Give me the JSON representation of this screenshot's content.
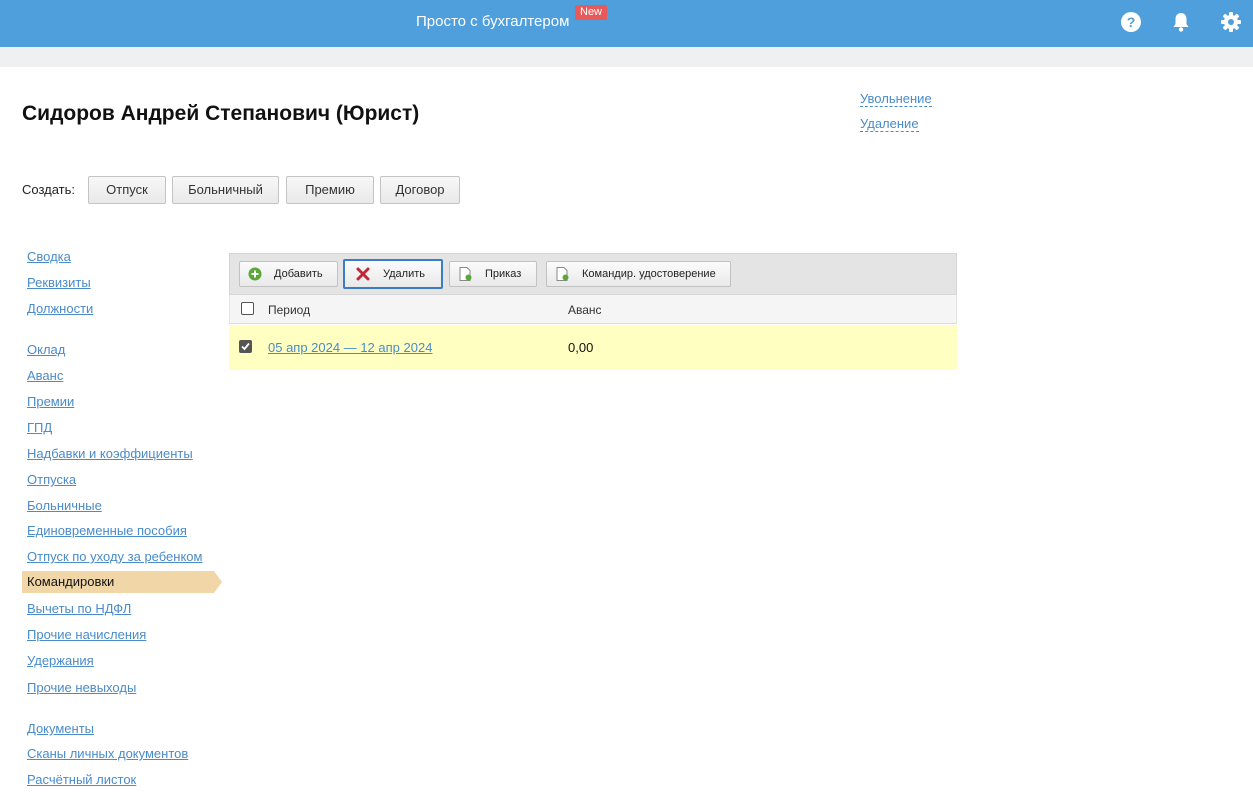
{
  "header": {
    "brand": "Просто с бухгалтером",
    "badge": "New",
    "icons": [
      "help-icon",
      "bell-icon",
      "gear-icon"
    ],
    "bg_color": "#4f9fdc"
  },
  "employee": {
    "title": "Сидоров Андрей Степанович (Юрист)"
  },
  "actions": {
    "dismiss": "Увольнение",
    "delete": "Удаление"
  },
  "create": {
    "label": "Создать:",
    "buttons": [
      "Отпуск",
      "Больничный",
      "Премию",
      "Договор"
    ]
  },
  "sidebar": {
    "items": [
      "Сводка",
      "Реквизиты",
      "Должности",
      "Оклад",
      "Аванс",
      "Премии",
      "ГПД",
      "Надбавки и коэффициенты",
      "Отпуска",
      "Больничные",
      "Единовременные пособия",
      "Отпуск по уходу за ребенком",
      "Командировки",
      "Вычеты по НДФЛ",
      "Прочие начисления",
      "Удержания",
      "Прочие невыходы",
      "Документы",
      "Сканы личных документов",
      "Расчётный листок"
    ],
    "active": "Командировки",
    "active_color": "#f1d7a8"
  },
  "toolbar": {
    "add": "Добавить",
    "delete": "Удалить",
    "order": "Приказ",
    "certificate": "Командир. удостоверение"
  },
  "table": {
    "columns": [
      "Период",
      "Аванс"
    ],
    "rows": [
      {
        "period": "05 апр 2024 — 12 апр 2024",
        "avans": "0,00",
        "checked": true
      }
    ],
    "selected_row_color": "#ffffc2"
  }
}
